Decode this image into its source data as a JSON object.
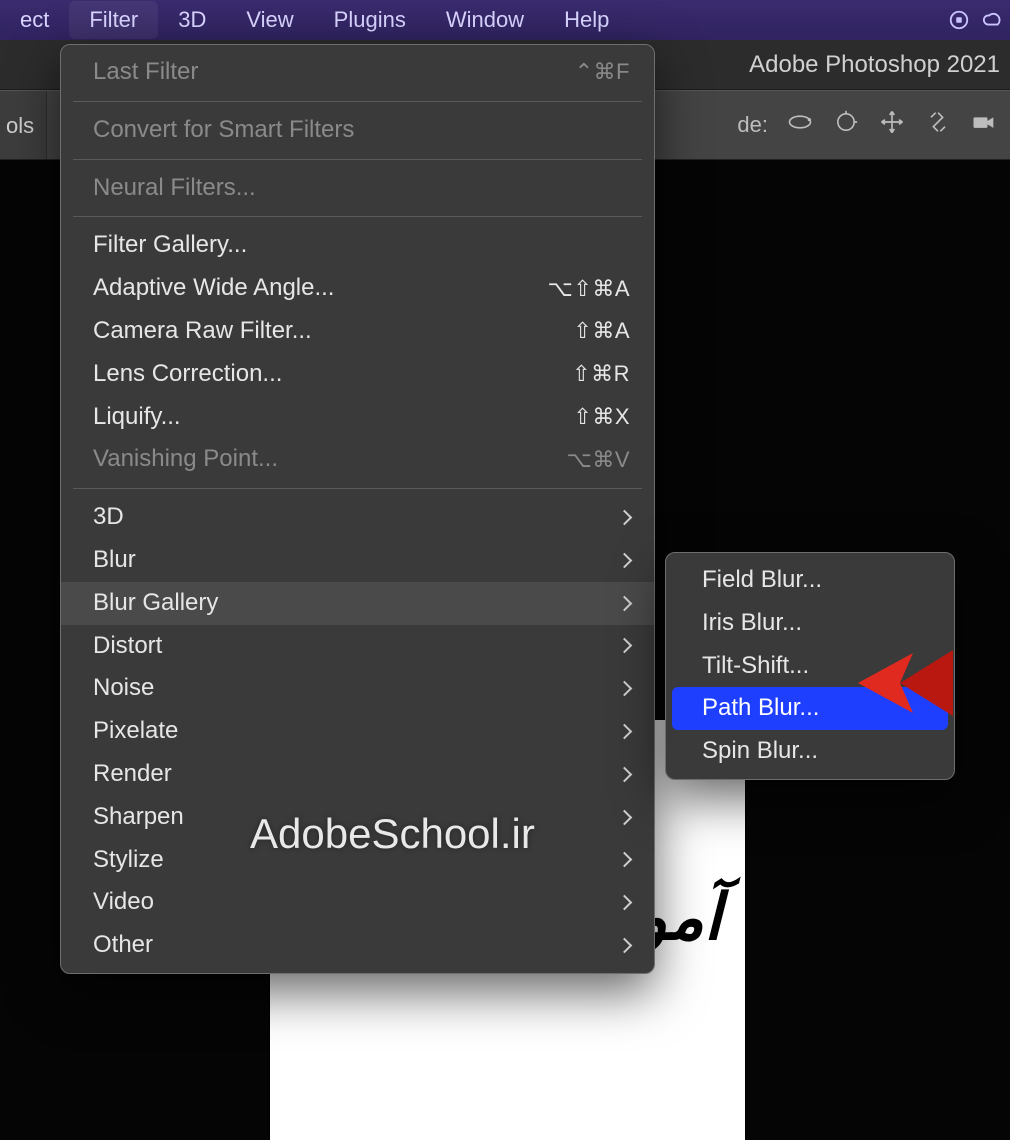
{
  "menubar": {
    "items": [
      "ect",
      "Filter",
      "3D",
      "View",
      "Plugins",
      "Window",
      "Help"
    ],
    "active_index": 1
  },
  "title": "Adobe Photoshop 2021",
  "optionsbar": {
    "tab": "ols",
    "mode_fragment": "de:"
  },
  "filter_menu": {
    "groups": [
      [
        {
          "label": "Last Filter",
          "shortcut": "⌃⌘F",
          "disabled": true
        }
      ],
      [
        {
          "label": "Convert for Smart Filters",
          "shortcut": "",
          "disabled": true
        }
      ],
      [
        {
          "label": "Neural Filters...",
          "shortcut": "",
          "disabled": true
        }
      ],
      [
        {
          "label": "Filter Gallery...",
          "shortcut": ""
        },
        {
          "label": "Adaptive Wide Angle...",
          "shortcut": "⌥⇧⌘A"
        },
        {
          "label": "Camera Raw Filter...",
          "shortcut": "⇧⌘A"
        },
        {
          "label": "Lens Correction...",
          "shortcut": "⇧⌘R"
        },
        {
          "label": "Liquify...",
          "shortcut": "⇧⌘X"
        },
        {
          "label": "Vanishing Point...",
          "shortcut": "⌥⌘V",
          "disabled": true
        }
      ],
      [
        {
          "label": "3D",
          "submenu": true
        },
        {
          "label": "Blur",
          "submenu": true
        },
        {
          "label": "Blur Gallery",
          "submenu": true,
          "highlight": true
        },
        {
          "label": "Distort",
          "submenu": true
        },
        {
          "label": "Noise",
          "submenu": true
        },
        {
          "label": "Pixelate",
          "submenu": true
        },
        {
          "label": "Render",
          "submenu": true
        },
        {
          "label": "Sharpen",
          "submenu": true
        },
        {
          "label": "Stylize",
          "submenu": true
        },
        {
          "label": "Video",
          "submenu": true
        },
        {
          "label": "Other",
          "submenu": true
        }
      ]
    ]
  },
  "blur_gallery_menu": {
    "items": [
      {
        "label": "Field Blur..."
      },
      {
        "label": "Iris Blur..."
      },
      {
        "label": "Tilt-Shift..."
      },
      {
        "label": "Path Blur...",
        "selected": true
      },
      {
        "label": "Spin Blur..."
      }
    ]
  },
  "document": {
    "persian_text": "آموزش فتوشاپ"
  },
  "watermark": "AdobeSchool.ir"
}
